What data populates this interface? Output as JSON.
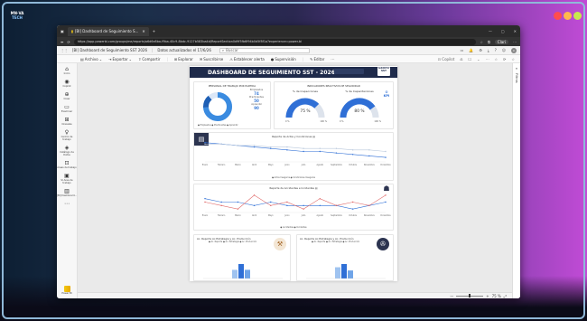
{
  "desktop": {
    "brand_badge_line1": "MN·VA",
    "brand_badge_line2": "TECH"
  },
  "browser": {
    "tab": {
      "title": "[BI] Dashboard de Seguimiento S...",
      "close": "✕"
    },
    "new_tab": "+",
    "window_controls": [
      "—",
      "▢",
      "✕"
    ],
    "url": "https://app.powerbi.com/groups/me/reports/a6d6e8ba-f9ba-40c9-8bdc-9127b583ba4d/ReportSection0d9f5fb6f94b0d5f8f1a?experience=power-bi",
    "address_icons": [
      "⬅",
      "⟳",
      "☆",
      "⧉",
      "⋯"
    ],
    "user_label": "Clari"
  },
  "pbi_header": {
    "report_name": "[BI] Dashboard de Seguimiento SST 2026",
    "sep": "|",
    "data_updated": "Datos actualizados el 17/6/26",
    "search_placeholder": "Buscar",
    "right_icons": [
      "▭",
      "🔔",
      "⚙",
      "⤓",
      "?",
      "☺",
      "C"
    ]
  },
  "toolbar": {
    "items": [
      {
        "icon": "▤",
        "label": "Archivo",
        "caret": "⌄"
      },
      {
        "icon": "⇥",
        "label": "Exportar",
        "caret": "⌄"
      },
      {
        "icon": "⇪",
        "label": "Compartir"
      },
      {
        "icon": "⊞",
        "label": "Explorar"
      },
      {
        "icon": "✉",
        "label": "Suscribirse"
      },
      {
        "icon": "⚠",
        "label": "Establecer alerta"
      },
      {
        "icon": "●",
        "label": "Supervisión"
      },
      {
        "icon": "✎",
        "label": "Editar"
      },
      {
        "icon": "⋯",
        "label": ""
      }
    ],
    "right": [
      "⊡ Copilot",
      "⎌",
      "☐",
      "⌄",
      "⋯",
      "☆",
      "⟳",
      "☆"
    ]
  },
  "leftnav": [
    {
      "icon": "⌂",
      "label": "Inicio"
    },
    {
      "icon": "◉",
      "label": "Copilot"
    },
    {
      "icon": "⊕",
      "label": "Crear"
    },
    {
      "icon": "▭",
      "label": "Examinar"
    },
    {
      "icon": "⊞",
      "label": "OneLake"
    },
    {
      "icon": "♀",
      "label": "Centro de trabajo"
    },
    {
      "icon": "◈",
      "label": "Catálogo de Datos"
    },
    {
      "icon": "⊡",
      "label": "Áreas de trabajo"
    },
    {
      "icon": "▣",
      "label": "SI Area de trabajo"
    },
    {
      "icon": "▥",
      "label": "[BI] Dashboard..."
    },
    {
      "icon": "⋯",
      "label": ""
    }
  ],
  "nav_bottom": {
    "label": "Power BI"
  },
  "filters": {
    "label": "Filtros",
    "icon": "«"
  },
  "report": {
    "title": "DASHBOARD DE SEGUIMIENTO SST - 2026",
    "logo_line1": "GRUPO",
    "logo_line2": "SST",
    "personal_title": "PERSONAL DE TRABAJO POR PARTIDA",
    "personal_stats": [
      {
        "label": "Empleados",
        "value": "74"
      },
      {
        "label": "Practicantes",
        "value": "50"
      },
      {
        "label": "Aprendiz",
        "value": "90"
      }
    ],
    "personal_legend": "● Empleados  ● Practicantes  ● Aprendiz",
    "indicadores_title": "INDICADORES REACTIVOS DE SEGURIDAD",
    "gauges": [
      {
        "title": "% de Inspecciones",
        "value_text": "75 %",
        "min": "0 %",
        "max": "100 %",
        "value": 0.75
      },
      {
        "title": "% de Capacitaciones",
        "value_text": "80 %",
        "min": "0 %",
        "max": "100 %",
        "value": 0.8
      }
    ],
    "kpi_badge": "KPI",
    "chart1_title": "Reporte de Actos y Condiciones ▤",
    "chart1_legend": "● Actos Inseguros  ● Condiciones Inseguras",
    "chart2_title": "Reporte de Accidentes e Incidentes ▤",
    "chart2_legend": "● Accidentes  ● Incidentes",
    "months": [
      "Enero",
      "Febrero",
      "Marzo",
      "Abril",
      "Mayo",
      "Junio",
      "Julio",
      "Agosto",
      "Septiembre",
      "Octubre",
      "Noviembre",
      "Diciembre"
    ],
    "bar1_title": "Ac. Reporte Ac.Estrategia y Ac. Producción",
    "bar1_legend": "● Ac. Reporte  ● Ac. Estrategia  ● Ac. Producción",
    "bar2_title": "Ac. Reporte Ac.Estrategia y Ac. Producción",
    "bar2_legend": "● Ac. Reporte  ● Ac. Estrategia  ● Ac. Producción"
  },
  "chart_data": [
    {
      "type": "line",
      "title": "Reporte de Actos y Condiciones",
      "categories": [
        "Enero",
        "Febrero",
        "Marzo",
        "Abril",
        "Mayo",
        "Junio",
        "Julio",
        "Agosto",
        "Septiembre",
        "Octubre",
        "Noviembre",
        "Diciembre"
      ],
      "series": [
        {
          "name": "Actos Inseguros",
          "values": [
            13,
            12,
            11,
            10,
            9,
            8,
            7,
            7,
            6,
            5,
            4,
            3
          ]
        },
        {
          "name": "Condiciones Inseguras",
          "values": [
            12,
            12,
            11,
            11,
            10,
            10,
            9,
            9,
            9,
            8,
            8,
            7
          ]
        }
      ]
    },
    {
      "type": "line",
      "title": "Reporte de Accidentes e Incidentes",
      "categories": [
        "Enero",
        "Febrero",
        "Marzo",
        "Abril",
        "Mayo",
        "Junio",
        "Julio",
        "Agosto",
        "Septiembre",
        "Octubre",
        "Noviembre",
        "Diciembre"
      ],
      "series": [
        {
          "name": "Accidentes",
          "values": [
            4,
            3,
            3,
            2,
            3,
            2,
            2,
            2,
            2,
            1,
            2,
            3
          ]
        },
        {
          "name": "Incidentes",
          "values": [
            3,
            2,
            1,
            5,
            2,
            3,
            1,
            4,
            2,
            3,
            2,
            5
          ]
        }
      ]
    },
    {
      "type": "bar",
      "title": "Ac. Reporte Ac.Estrategia y Ac. Producción",
      "categories": [
        "Ac. Reporte",
        "Ac. Estrategia",
        "Ac. Producción"
      ],
      "values": [
        6,
        10,
        6
      ]
    },
    {
      "type": "bar",
      "title": "Ac. Reporte Ac.Estrategia y Ac. Producción",
      "categories": [
        "Ac. Reporte",
        "Ac. Estrategia",
        "Ac. Producción"
      ],
      "values": [
        7,
        9,
        5
      ]
    }
  ],
  "status": {
    "zoom_minus": "—",
    "zoom_plus": "+",
    "zoom_value": "75 %",
    "fit_icon": "⤢"
  },
  "colors": {
    "accent": "#2f6fd6",
    "title_bar": "#1e2a4a",
    "line_alt": "#e06a6a",
    "powerbi": "#f2c811"
  }
}
